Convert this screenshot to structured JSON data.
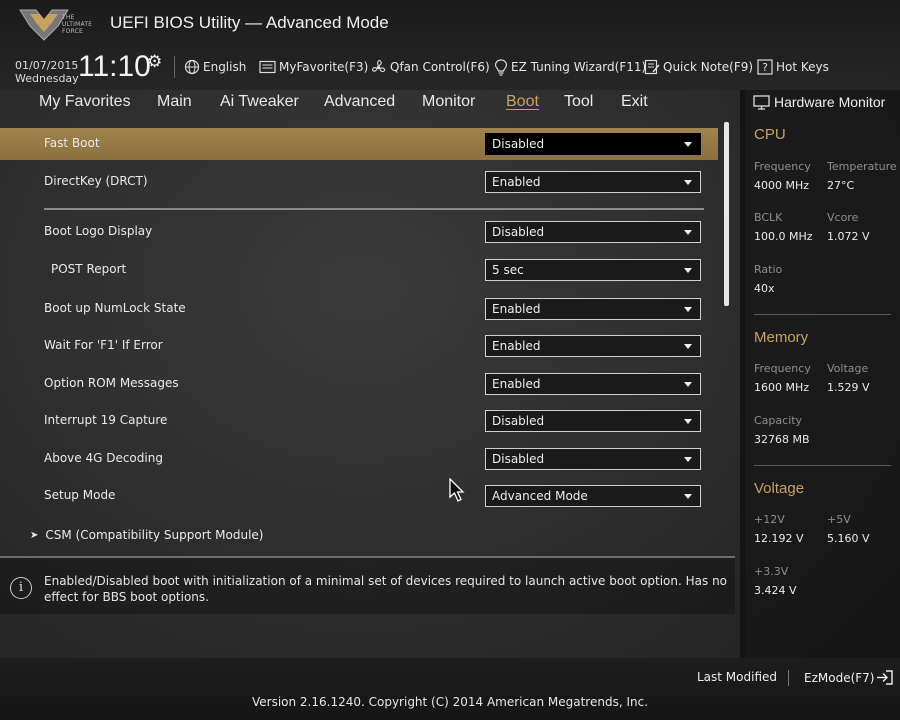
{
  "header": {
    "title": "UEFI BIOS Utility — Advanced Mode",
    "logo_text": "THE ULTIMATE FORCE",
    "date": "01/07/2015",
    "day": "Wednesday",
    "time": "11:10",
    "buttons": [
      {
        "label": "English",
        "icon": "globe-icon"
      },
      {
        "label": "MyFavorite(F3)",
        "icon": "favorite-icon"
      },
      {
        "label": "Qfan Control(F6)",
        "icon": "fan-icon"
      },
      {
        "label": "EZ Tuning Wizard(F11)",
        "icon": "lightbulb-icon"
      },
      {
        "label": "Quick Note(F9)",
        "icon": "note-icon"
      },
      {
        "label": "Hot Keys",
        "icon": "question-icon"
      }
    ]
  },
  "tabs": [
    {
      "label": "My Favorites"
    },
    {
      "label": "Main"
    },
    {
      "label": "Ai Tweaker"
    },
    {
      "label": "Advanced"
    },
    {
      "label": "Monitor"
    },
    {
      "label": "Boot",
      "active": true
    },
    {
      "label": "Tool"
    },
    {
      "label": "Exit"
    }
  ],
  "settings": [
    {
      "label": "Fast Boot",
      "value": "Disabled",
      "selected": true
    },
    {
      "label": "DirectKey (DRCT)",
      "value": "Enabled"
    },
    {
      "label": "Boot Logo Display",
      "value": "Disabled"
    },
    {
      "label": "POST Report",
      "value": "5 sec"
    },
    {
      "label": "Boot up NumLock State",
      "value": "Enabled"
    },
    {
      "label": "Wait For 'F1' If Error",
      "value": "Enabled"
    },
    {
      "label": "Option ROM Messages",
      "value": "Enabled"
    },
    {
      "label": "Interrupt 19 Capture",
      "value": "Disabled"
    },
    {
      "label": "Above 4G Decoding",
      "value": "Disabled"
    },
    {
      "label": "Setup Mode",
      "value": "Advanced Mode"
    }
  ],
  "submenu": {
    "arrow": "➤",
    "label": "CSM (Compatibility Support Module)"
  },
  "help": {
    "icon": "i",
    "text": "Enabled/Disabled boot with initialization of a minimal set of devices required to launch active boot option. Has no effect for BBS boot options."
  },
  "hardware_monitor": {
    "title": "Hardware Monitor",
    "cpu": {
      "heading": "CPU",
      "frequency_label": "Frequency",
      "frequency": "4000 MHz",
      "temperature_label": "Temperature",
      "temperature": "27°C",
      "bclk_label": "BCLK",
      "bclk": "100.0 MHz",
      "vcore_label": "Vcore",
      "vcore": "1.072 V",
      "ratio_label": "Ratio",
      "ratio": "40x"
    },
    "memory": {
      "heading": "Memory",
      "frequency_label": "Frequency",
      "frequency": "1600 MHz",
      "voltage_label": "Voltage",
      "voltage": "1.529 V",
      "capacity_label": "Capacity",
      "capacity": "32768 MB"
    },
    "voltage": {
      "heading": "Voltage",
      "v12_label": "+12V",
      "v12": "12.192 V",
      "v5_label": "+5V",
      "v5": "5.160 V",
      "v33_label": "+3.3V",
      "v33": "3.424 V"
    }
  },
  "footer": {
    "last_modified": "Last Modified",
    "ezmode": "EzMode(F7)",
    "version": "Version 2.16.1240. Copyright (C) 2014 American Megatrends, Inc."
  },
  "colors": {
    "accent": "#c8a062",
    "selected_row": "#9a7d47",
    "background": "#2b2b2b"
  }
}
